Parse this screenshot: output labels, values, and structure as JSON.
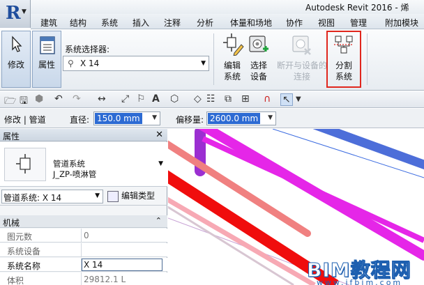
{
  "window": {
    "title": "Autodesk Revit 2016 -   烯"
  },
  "ribbon_tabs": [
    "建筑",
    "结构",
    "系统",
    "插入",
    "注释",
    "分析",
    "体量和场地",
    "协作",
    "视图",
    "管理",
    "附加模块"
  ],
  "ribbon": {
    "modify_label": "修改",
    "properties_label": "属性",
    "system_selector_label": "系统选择器:",
    "system_selector_value": "X 14",
    "buttons": [
      {
        "line1": "编辑",
        "line2": "系统",
        "icon": "edit-system-icon",
        "enabled": true
      },
      {
        "line1": "选择",
        "line2": "设备",
        "icon": "select-equipment-icon",
        "enabled": true
      },
      {
        "line1": "断开与设备的",
        "line2": "连接",
        "icon": "disconnect-equipment-icon",
        "enabled": false
      },
      {
        "line1": "分割",
        "line2": "系统",
        "icon": "divide-system-icon",
        "enabled": true,
        "highlighted": true
      }
    ]
  },
  "options_bar": {
    "context": "修改 | 管道",
    "diameter_label": "直径:",
    "diameter_value": "150.0 mm",
    "offset_label": "偏移量:",
    "offset_value": "2600.0 mm"
  },
  "properties": {
    "header": "属性",
    "type_family": "管道系统",
    "type_name": "J_ZP-喷淋管",
    "instance_filter": "管道系统: X 14",
    "edit_type_label": "编辑类型",
    "group": "机械",
    "rows": [
      {
        "key": "图元数",
        "value": "0"
      },
      {
        "key": "系统设备",
        "value": ""
      },
      {
        "key": "系统名称",
        "value": "X 14"
      },
      {
        "key": "体积",
        "value": "29812.1 L"
      }
    ]
  },
  "viewport": {
    "pipe_colors": {
      "magenta": "#e526e8",
      "red": "#f00d0d",
      "blue": "#4d6ed9",
      "pink": "#f7a9b4",
      "purple": "#9b2fd1"
    }
  },
  "watermark": {
    "main": "BIM教程网",
    "url": "www.ifbim.com"
  }
}
